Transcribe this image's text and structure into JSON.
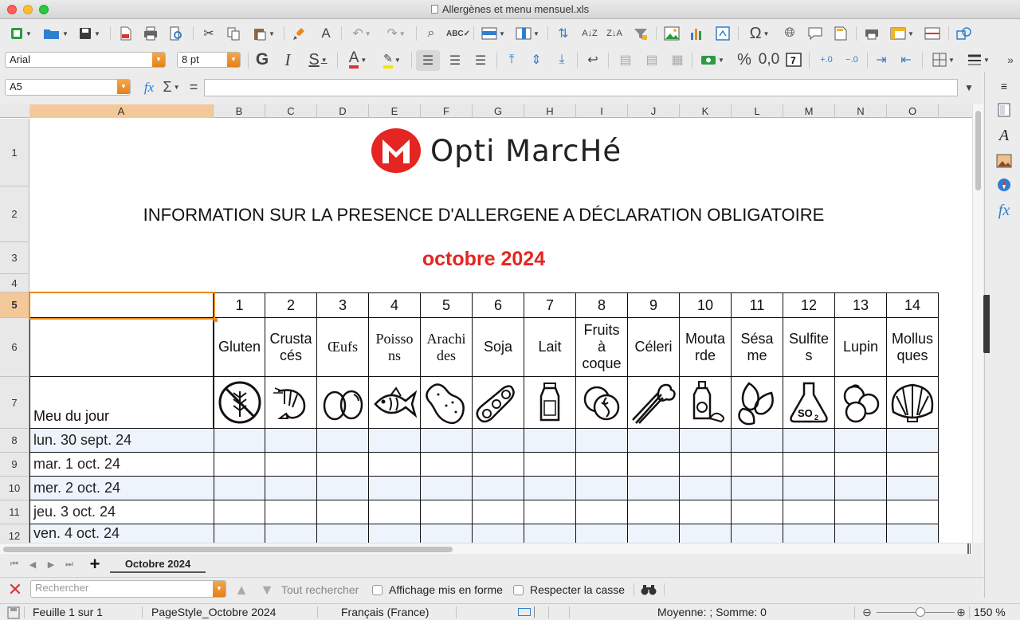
{
  "window": {
    "title": "Allergènes et menu mensuel.xls"
  },
  "format_bar": {
    "font_name": "Arial",
    "font_size": "8 pt",
    "bold_label": "G",
    "italic_label": "I",
    "underline_label": "S",
    "percent_label": "%",
    "decimal_label": "0,0"
  },
  "formula_bar": {
    "name_box": "A5",
    "fx_label": "fx",
    "sum_label": "Σ",
    "equals_label": "=",
    "content": ""
  },
  "columns": [
    "A",
    "B",
    "C",
    "D",
    "E",
    "F",
    "G",
    "H",
    "I",
    "J",
    "K",
    "L",
    "M",
    "N",
    "O"
  ],
  "rows": [
    "1",
    "2",
    "3",
    "4",
    "5",
    "6",
    "7",
    "8",
    "9",
    "10",
    "11",
    "12"
  ],
  "sheet": {
    "logo_text": "Opti MarcHé",
    "main_title": "INFORMATION SUR LA PRESENCE D'ALLERGENE A DÉCLARATION OBLIGATOIRE",
    "month_title": "octobre 2024",
    "menu_header": "Meu du jour",
    "allergens": [
      {
        "num": "1",
        "name": "Gluten",
        "icon": "wheat-icon"
      },
      {
        "num": "2",
        "name": "Crusta cés",
        "icon": "shrimp-icon"
      },
      {
        "num": "3",
        "name": "Œufs",
        "icon": "eggs-icon"
      },
      {
        "num": "4",
        "name": "Poisso ns",
        "icon": "fish-icon"
      },
      {
        "num": "5",
        "name": "Arachi des",
        "icon": "peanut-icon"
      },
      {
        "num": "6",
        "name": "Soja",
        "icon": "soy-icon"
      },
      {
        "num": "7",
        "name": "Lait",
        "icon": "milk-icon"
      },
      {
        "num": "8",
        "name": "Fruits à coque",
        "icon": "walnut-icon"
      },
      {
        "num": "9",
        "name": "Céleri",
        "icon": "celery-icon"
      },
      {
        "num": "10",
        "name": "Mouta rde",
        "icon": "mustard-icon"
      },
      {
        "num": "11",
        "name": "Sésa me",
        "icon": "sesame-icon"
      },
      {
        "num": "12",
        "name": "Sulfite s",
        "icon": "sulfite-flask-icon"
      },
      {
        "num": "13",
        "name": "Lupin",
        "icon": "lupin-icon"
      },
      {
        "num": "14",
        "name": "Mollus ques",
        "icon": "shell-icon"
      }
    ],
    "days": [
      "lun. 30 sept. 24",
      "mar. 1 oct. 24",
      "mer. 2 oct. 24",
      "jeu. 3 oct. 24",
      "ven. 4 oct. 24"
    ]
  },
  "tabs": {
    "active_tab": "Octobre 2024",
    "add_label": "+"
  },
  "findbar": {
    "search_placeholder": "Rechercher",
    "find_all": "Tout rechercher",
    "formatted_display": "Affichage mis en forme",
    "match_case": "Respecter la casse"
  },
  "status": {
    "sheet_info": "Feuille 1 sur 1",
    "page_style": "PageStyle_Octobre 2024",
    "language": "Français (France)",
    "summary": "Moyenne: ; Somme: 0",
    "zoom": "150 %"
  },
  "colors": {
    "accent_orange": "#e8891e",
    "brand_red": "#e52521",
    "stripe_blue": "#eef4fb"
  }
}
